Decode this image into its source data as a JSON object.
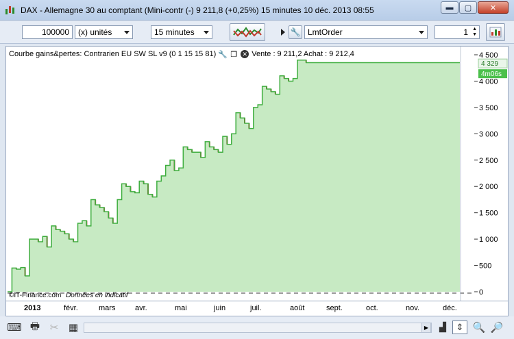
{
  "window": {
    "title": "DAX - Allemagne 30 au comptant (Mini-contr (-)    9 211,8 (+0,25%)    15 minutes  10 déc. 2013 08:55",
    "min_glyph": "▬",
    "max_glyph": "▢",
    "close_glyph": "✕"
  },
  "toolbar": {
    "quantity": "100000",
    "units": "(x) unités",
    "timeframe": "15 minutes",
    "order_type": "LmtOrder",
    "count": "1"
  },
  "chart_header": {
    "title": "Courbe gains&pertes: Contrarien EU SW SL v9 (0 1 15 15 81)",
    "quote": "Vente : 9 211,2 Achat : 9 212,4"
  },
  "footnote": {
    "source": "©IT-Finance.com",
    "disclaimer": "Données en indicatif"
  },
  "chart_data": {
    "type": "area",
    "x": [
      0,
      0.5,
      1,
      1.5,
      2,
      2.5,
      3,
      3.5,
      4,
      4.5,
      5,
      5.5,
      6,
      6.5,
      7,
      7.5,
      8,
      8.5,
      9,
      9.5,
      10,
      10.5,
      11,
      11.5,
      12,
      12.5,
      13,
      13.5,
      14,
      14.5,
      15,
      15.5,
      16,
      16.5,
      17,
      17.5,
      18,
      18.5,
      19,
      19.5,
      20,
      20.5,
      21,
      21.5,
      22,
      22.5,
      23,
      23.5,
      24,
      24.5,
      25,
      25.5,
      26,
      26.5,
      27,
      27.5,
      28,
      28.5,
      29,
      29.5,
      30,
      30.5,
      31,
      31.5,
      32,
      32.5,
      33,
      33.5,
      34,
      34.5,
      35,
      35.5,
      36,
      36.5,
      37,
      37.5,
      38,
      38.5,
      39,
      39.5,
      40,
      40.5,
      41,
      41.5,
      42,
      42.5,
      43,
      43.5,
      44,
      44.5,
      45,
      45.5,
      46,
      46.5,
      47,
      47.5,
      48,
      48.5,
      49,
      49.5,
      50,
      50.5,
      51,
      51.5
    ],
    "y": [
      0,
      450,
      430,
      460,
      300,
      1000,
      1000,
      950,
      1050,
      850,
      1250,
      1180,
      1150,
      1100,
      1000,
      950,
      1300,
      1350,
      1250,
      1750,
      1650,
      1600,
      1520,
      1400,
      1300,
      1750,
      2050,
      2000,
      1900,
      1880,
      2100,
      2050,
      1850,
      1800,
      2100,
      2200,
      2400,
      2500,
      2300,
      2350,
      2750,
      2700,
      2650,
      2650,
      2550,
      2850,
      2750,
      2700,
      2650,
      2950,
      2800,
      3000,
      3400,
      3300,
      3200,
      3100,
      3500,
      3550,
      3900,
      3850,
      3800,
      3750,
      4100,
      4050,
      4000,
      4050,
      4400,
      4400,
      4350,
      4350,
      4350,
      4350,
      4350,
      4350,
      4350,
      4350,
      4350,
      4350,
      4350,
      4350,
      4350,
      4350,
      4350,
      4350,
      4350,
      4350,
      4350,
      4350,
      4350,
      4350,
      4350,
      4350,
      4350,
      4350,
      4350,
      4350,
      4350,
      4350,
      4350,
      4350,
      4350,
      4350,
      4350,
      4350
    ],
    "ylim": [
      0,
      4500
    ],
    "yticks": [
      "0",
      "500",
      "1 000",
      "1 500",
      "2 000",
      "2 500",
      "3 000",
      "3 500",
      "4 000",
      "4 500"
    ],
    "ytick_values": [
      0,
      500,
      1000,
      1500,
      2000,
      2500,
      3000,
      3500,
      4000,
      4500
    ],
    "current_value": "4 329",
    "time_badge": "4m06s",
    "line_color": "#3fae3f",
    "fill_color": "#c7eac3",
    "drawdown_color": "#b03a2e",
    "grid": false
  },
  "time_axis": {
    "year": "2013",
    "months": [
      "févr.",
      "mars",
      "avr.",
      "mai",
      "juin",
      "juil.",
      "août",
      "sept.",
      "oct.",
      "nov.",
      "déc."
    ]
  }
}
